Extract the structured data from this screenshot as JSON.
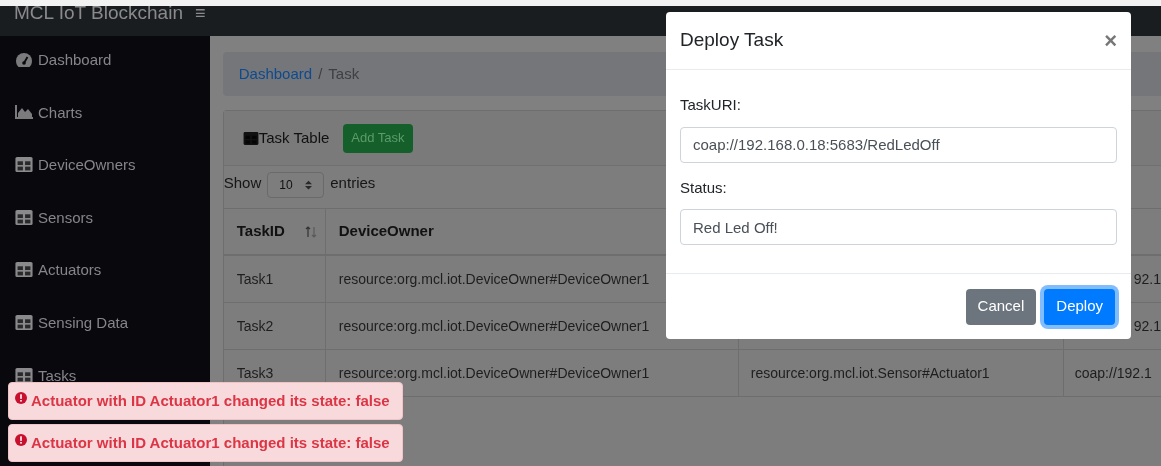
{
  "navbar": {
    "title": "MCL IoT Blockchain",
    "menu_glyph": "≡"
  },
  "sidebar": {
    "items": [
      {
        "label": "Dashboard"
      },
      {
        "label": "Charts"
      },
      {
        "label": "DeviceOwners"
      },
      {
        "label": "Sensors"
      },
      {
        "label": "Actuators"
      },
      {
        "label": "Sensing Data"
      },
      {
        "label": "Tasks"
      }
    ]
  },
  "breadcrumb": {
    "items": [
      "Dashboard",
      "Task"
    ],
    "separator": "/"
  },
  "card": {
    "title": "Task Table",
    "add_button": "Add Task",
    "length": {
      "prefix": "Show",
      "value": "10",
      "suffix": "entries"
    }
  },
  "table": {
    "columns": [
      "TaskID",
      "DeviceOwner"
    ],
    "rows": [
      {
        "task_id": "Task1",
        "device_owner": "resource:org.mcl.iot.DeviceOwner#DeviceOwner1",
        "uri": "92.1"
      },
      {
        "task_id": "Task2",
        "device_owner": "resource:org.mcl.iot.DeviceOwner#DeviceOwner1",
        "uri": "92.1"
      },
      {
        "task_id": "Task3",
        "device_owner": "resource:org.mcl.iot.DeviceOwner#DeviceOwner1",
        "actuator": "resource:org.mcl.iot.Sensor#Actuator1",
        "uri": "coap://192.1"
      }
    ]
  },
  "modal": {
    "title": "Deploy Task",
    "close": "×",
    "fields": [
      {
        "label": "TaskURI:",
        "value": "coap://192.168.0.18:5683/RedLedOff"
      },
      {
        "label": "Status:",
        "value": "Red Led Off!"
      }
    ],
    "buttons": [
      {
        "label": "Cancel",
        "kind": "secondary",
        "focused": false
      },
      {
        "label": "Deploy",
        "kind": "primary",
        "focused": true
      }
    ]
  },
  "toasts": [
    {
      "text": "Actuator with ID Actuator1 changed its state: false"
    },
    {
      "text": "Actuator with ID Actuator1 changed its state: false"
    }
  ]
}
